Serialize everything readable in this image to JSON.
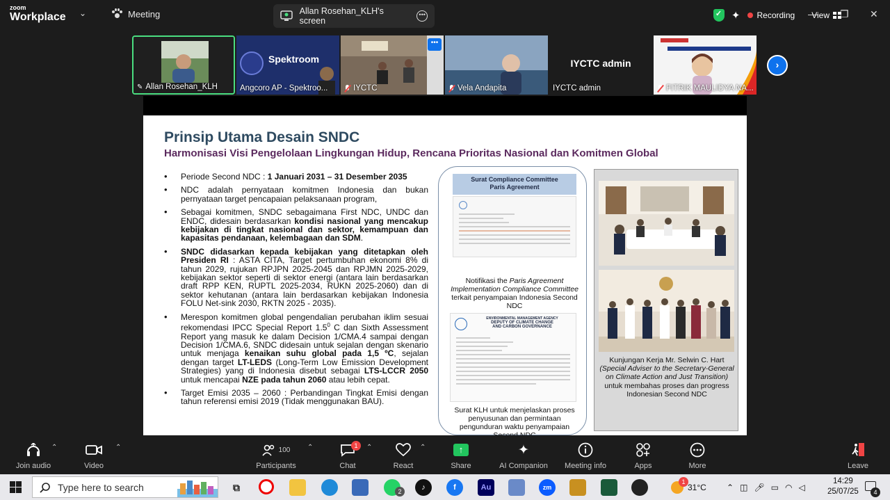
{
  "topbar": {
    "brand_small": "zoom",
    "brand_big": "Workplace",
    "meeting_label": "Meeting",
    "screen_tab_label": "Allan Rosehan_KLH's screen",
    "recording_label": "Recording",
    "view_label": "View"
  },
  "participants_strip": [
    {
      "name": "Allan Rosehan_KLH"
    },
    {
      "name": "Angcoro AP - Spektroo..."
    },
    {
      "name": "IYCTC"
    },
    {
      "name": "Vela Andapita"
    },
    {
      "name": "IYCTC admin",
      "center_text": "IYCTC admin"
    },
    {
      "name": "FITRIK MAULIDYA NA..."
    }
  ],
  "spektroom_logo_text": "Spektroom",
  "slide": {
    "title": "Prinsip Utama Desain SNDC",
    "subtitle": "Harmonisasi Visi Pengelolaan Lingkungan Hidup, Rencana Prioritas Nasional dan Komitmen Global",
    "b1_a": "Periode Second NDC : ",
    "b1_b": "1 Januari 2031 – 31 Desember 2035",
    "b2": "NDC adalah pernyataan komitmen Indonesia dan bukan pernyataan target pencapaian pelaksanaan program,",
    "b3_a": "Sebagai komitmen, SNDC sebagaimana First NDC, UNDC dan ENDC, didesain berdasarkan ",
    "b3_b": "kondisi nasional yang mencakup kebijakan di tingkat nasional dan sektor, kemampuan dan kapasitas pendanaan, kelembagaan dan SDM",
    "b3_c": ".",
    "b4_a": "SNDC didasarkan kepada kebijakan yang ditetapkan oleh Presiden RI",
    "b4_b": " : ASTA CITA, Target pertumbuhan ekonomi 8% di tahun 2029, rujukan RPJPN 2025-2045 dan RPJMN 2025-2029, kebijakan sektor seperti di sektor energi (antara lain berdasarkan draft RPP KEN, RUPTL 2025-2034, RUKN 2025-2060) dan di sektor kehutanan (antara lain berdasarkan kebijakan Indonesia FOLU Net-sink 2030, RKTN 2025 - 2035).",
    "b5_a": "Merespon komitmen global pengendalian perubahan iklim sesuai rekomendasi IPCC Special Report 1.5",
    "b5_sup": "0",
    "b5_b": " C dan Sixth Assessment Report yang masuk ke dalam Decision 1/CMA.4 sampai dengan Decision 1/CMA.6, SNDC didesain untuk sejalan dengan skenario untuk menjaga ",
    "b5_c": "kenaikan suhu global pada 1,5 ºC",
    "b5_d": ", sejalan dengan target ",
    "b5_e": "LT-LEDS",
    "b5_f": " (Long-Term Low Emission Development Strategies) yang di Indonesia disebut sebagai ",
    "b5_g": "LTS-LCCR 2050",
    "b5_h": " untuk mencapai ",
    "b5_i": "NZE pada tahun 2060",
    "b5_j": " atau lebih cepat.",
    "b6": "Target Emisi 2035 – 2060 : Perbandingan Tingkat Emisi dengan tahun referensi emisi 2019 (Tidak menggunakan BAU).",
    "doc_head_1": "Surat Compliance  Committee",
    "doc_head_2": "Paris Agreement",
    "doc_cap1_a": "Notifikasi the ",
    "doc_cap1_b": "Paris Agreement Implementation Compliance Committee",
    "doc_cap1_c": " terkait penyampaian Indonesia Second NDC",
    "doc2_agency_1": "ENVIRONMENTAL MANAGEMENT AGENCY",
    "doc2_agency_2": "DEPUTY OF CLIMATE CHANGE",
    "doc2_agency_3": "AND CARBON GOVERNANCE",
    "doc_cap2": "Surat KLH untuk menjelaskan proses penyusunan dan permintaan pengunduran waktu penyampaian Second NDC",
    "photo_cap_a": "Kunjungan Kerja Mr. Selwin C. Hart ",
    "photo_cap_b": "(Special Adviser to the Secretary-General on Climate Action and Just Transition)",
    "photo_cap_c": " untuk membahas proses  dan progress Indonesian Second NDC"
  },
  "toolbar": {
    "join_audio": "Join audio",
    "video": "Video",
    "participants": "Participants",
    "participants_count": "100",
    "chat": "Chat",
    "chat_badge": "1",
    "react": "React",
    "share": "Share",
    "ai_companion": "AI Companion",
    "meeting_info": "Meeting info",
    "apps": "Apps",
    "more": "More",
    "leave": "Leave"
  },
  "taskbar": {
    "search_placeholder": "Type here to search",
    "whatsapp_badge": "2",
    "weather": "31°C",
    "weather_badge": "1",
    "time": "14:29",
    "date": "25/07/25",
    "notif_count": "4"
  },
  "colors": {
    "accent_green": "#4ade80",
    "zoom_blue": "#0e72ed",
    "record_red": "#ef4444",
    "title_blue": "#2e4a60",
    "subtitle_purple": "#5b2a5e"
  }
}
